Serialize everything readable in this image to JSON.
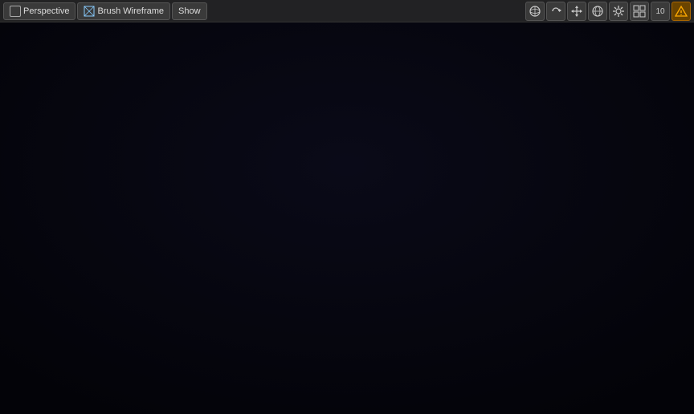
{
  "toolbar": {
    "perspective_label": "Perspective",
    "brush_label": "Brush Wireframe",
    "show_label": "Show"
  },
  "right_icons": [
    {
      "name": "sphere-icon",
      "symbol": "⊙"
    },
    {
      "name": "rotate-icon",
      "symbol": "↻"
    },
    {
      "name": "move-icon",
      "symbol": "⤢"
    },
    {
      "name": "globe-icon",
      "symbol": "🌐"
    },
    {
      "name": "settings-icon",
      "symbol": "⚙"
    },
    {
      "name": "grid-icon",
      "symbol": "⊞"
    },
    {
      "name": "number-label",
      "symbol": "10"
    },
    {
      "name": "warning-icon",
      "symbol": "⚠"
    }
  ],
  "colors": {
    "wireframe": "#00d4c8",
    "grid": "#1a1a3a",
    "grid_lines": "#1e1e4a",
    "background_top": "#050510",
    "background_bottom": "#0a0a1a"
  }
}
